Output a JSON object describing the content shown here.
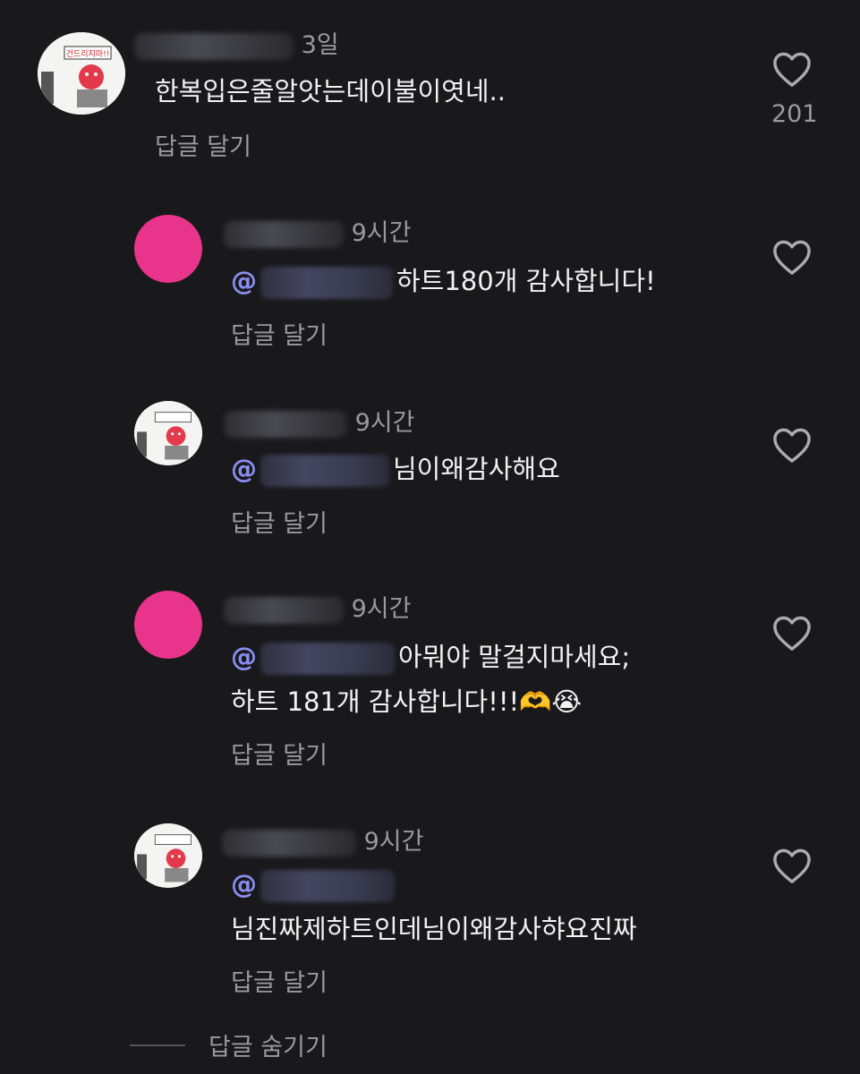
{
  "comments": [
    {
      "time": "3일",
      "text": "한복입은줄알앗는데이불이엿네..",
      "reply_label": "답글 달기",
      "like_count": "201"
    },
    {
      "time": "9시간",
      "mention_icon": "@",
      "text": "하트180개 감사합니다!",
      "reply_label": "답글 달기"
    },
    {
      "time": "9시간",
      "mention_icon": "@",
      "text": "님이왜감사해요",
      "reply_label": "답글 달기"
    },
    {
      "time": "9시간",
      "mention_icon": "@",
      "text": "아뭐야 말걸지마세요;",
      "text2": "하트 181개 감사합니다!!!🫶😭",
      "reply_label": "답글 달기"
    },
    {
      "time": "9시간",
      "mention_icon": "@",
      "text": "님진짜제하트인데님이왜감사햐요진짜",
      "reply_label": "답글 달기"
    }
  ],
  "avatar_sign_text": "건드리지마!!",
  "hide_replies_label": "답글 숨기기",
  "colors": {
    "background": "#19191c",
    "text": "#f2f2f2",
    "muted": "#9a9a9e",
    "pink_avatar": "#e8348a",
    "mention": "#8a8ef0"
  },
  "icons": {
    "like": "heart-outline-icon",
    "mention": "threads-at-icon"
  }
}
